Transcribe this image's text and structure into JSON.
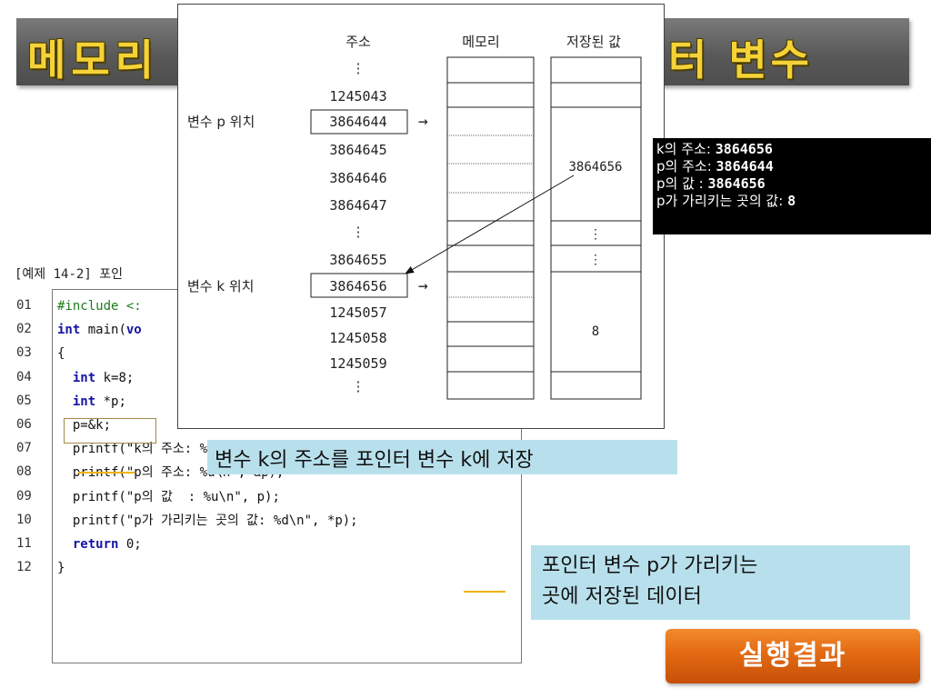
{
  "title": {
    "left": "메모리",
    "right": "터 변수"
  },
  "example_caption": "[예제 14-2] 포인",
  "code": {
    "line_numbers": [
      "01",
      "02",
      "03",
      "04",
      "05",
      "06",
      "07",
      "08",
      "09",
      "10",
      "11",
      "12"
    ],
    "lines": [
      {
        "pp": "#include <:"
      },
      {
        "kw": "int",
        "text": " main(",
        "kw2": "vo"
      },
      {
        "text": "{"
      },
      {
        "kw": "  int",
        "text": " k=8;"
      },
      {
        "kw": "  int",
        "text": " *p;"
      },
      {
        "text": "  p=&k;"
      },
      {
        "text": "  printf(\"k의 주소: %u\\n\", &k);"
      },
      {
        "text": "  printf(\"p의 주소: %u\\n\", &p);"
      },
      {
        "text": "  printf(\"p의 값  : %u\\n\", p);"
      },
      {
        "text": "  printf(\"p가 가리키는 곳의 값: %d\\n\", *p);"
      },
      {
        "kw": "  return",
        "text": " 0;"
      },
      {
        "text": "}"
      }
    ]
  },
  "diagram": {
    "headers": {
      "address": "주소",
      "memory": "메모리",
      "stored_value": "저장된 값"
    },
    "addresses": [
      "⋮",
      "1245043",
      "3864644",
      "3864645",
      "3864646",
      "3864647",
      "⋮",
      "3864655",
      "3864656",
      "1245057",
      "1245058",
      "1245059",
      "⋮"
    ],
    "labels": {
      "p_location": "변수 p 위치",
      "k_location": "변수 k 위치"
    },
    "arrow": "→",
    "stored": {
      "p_value": "3864656",
      "k_value": "8",
      "dots": "⋮"
    }
  },
  "console": {
    "lines": [
      {
        "label": "k의 주소: ",
        "value": "3864656"
      },
      {
        "label": "p의 주소: ",
        "value": "3864644"
      },
      {
        "label": "p의 값  : ",
        "value": "3864656"
      },
      {
        "label": "p가 가리키는 곳의 값: ",
        "value": "8"
      }
    ]
  },
  "callouts": {
    "first": "변수 k의 주소를 포인터 변수 k에 저장",
    "second_line1": "포인터 변수 p가 가리키는",
    "second_line2": "곳에 저장된 데이터"
  },
  "run_button": "실행결과",
  "colors": {
    "title_text": "#f5d237",
    "title_bg": "#595959",
    "callout_bg": "#b8e0ec",
    "button": "#e36a12",
    "keyword": "#1414a0",
    "underline": "#f2b300"
  }
}
